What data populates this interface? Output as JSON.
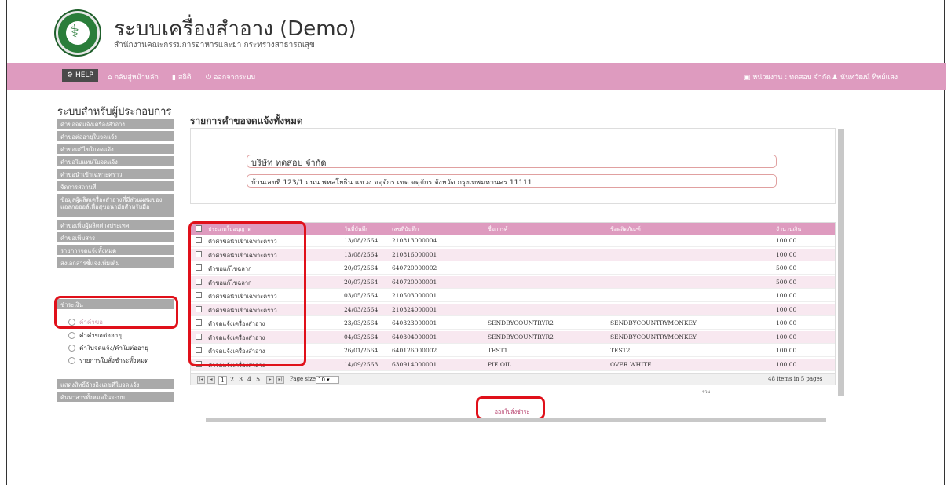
{
  "header": {
    "title": "ระบบเครื่องสำอาง (Demo)",
    "subtitle": "สำนักงานคณะกรรมการอาหารและยา กระทรวงสาธารณสุข"
  },
  "navbar": {
    "help": "HELP",
    "home": "กลับสู่หน้าหลัก",
    "stats": "สถิติ",
    "logout": "ออกจากระบบ",
    "agency": "หน่วยงาน : ทดสอบ จำกัด",
    "user": "นันทวัฒน์ ทิพย์แสง"
  },
  "sidebar": {
    "title": "ระบบสำหรับผู้ประกอบการ",
    "items": [
      "คำขอจดแจ้งเครื่องสำอาง",
      "คำขอต่ออายุใบจดแจ้ง",
      "คำขอแก้ไขใบจดแจ้ง",
      "คำขอใบแทนใบจดแจ้ง",
      "คำขอนำเข้าเฉพาะคราว",
      "จัดการสถานที่",
      "ข้อมูลผู้ผลิตเครื่องสำอางที่มีส่วนผสมของแอลกอฮอล์เพื่อสุขอนามัยสำหรับมือ",
      "คำขอเพิ่มผู้ผลิตต่างประเทศ",
      "คำขอเพิ่มสาร",
      "รายการจดแจ้งทั้งหมด",
      "ส่งเอกสารชี้แจงเพิ่มเติม",
      "ชำระเงิน",
      "แสดงสิทธิ์อ้างอิงเลขที่ใบจดแจ้ง",
      "ค้นหาสารทั้งหมดในระบบ"
    ],
    "sub_items": [
      "คำคำขอ",
      "คำคำขอต่ออายุ",
      "คำใบจดแจ้ง/คำใบต่ออายุ",
      "รายการใบสั่งชำระทั้งหมด"
    ]
  },
  "main": {
    "title": "รายการคำขอจดแจ้งทั้งหมด",
    "company_name": "บริษัท ทดสอบ จำกัด",
    "company_address": "บ้านเลขที่ 123/1 ถนน พหลโยธิน แขวง จตุจักร เขต จตุจักร จังหวัด กรุงเทพมหานคร 11111",
    "columns": [
      "ประเภทใบอนุญาต",
      "วันที่บันทึก",
      "เลขที่บันทึก",
      "ชื่อการค้า",
      "ชื่อผลิตภัณฑ์",
      "จำนวนเงิน"
    ],
    "rows": [
      [
        "คำคำขอนำเข้าเฉพาะคราว",
        "13/08/2564",
        "210813000004",
        "",
        "",
        "100.00"
      ],
      [
        "คำคำขอนำเข้าเฉพาะคราว",
        "13/08/2564",
        "210816000001",
        "",
        "",
        "100.00"
      ],
      [
        "คำขอแก้ไขฉลาก",
        "20/07/2564",
        "640720000002",
        "",
        "",
        "500.00"
      ],
      [
        "คำขอแก้ไขฉลาก",
        "20/07/2564",
        "640720000001",
        "",
        "",
        "500.00"
      ],
      [
        "คำคำขอนำเข้าเฉพาะคราว",
        "03/05/2564",
        "210503000001",
        "",
        "",
        "100.00"
      ],
      [
        "คำคำขอนำเข้าเฉพาะคราว",
        "24/03/2564",
        "210324000001",
        "",
        "",
        "100.00"
      ],
      [
        "คำจดแจ้งเครื่องสำอาง",
        "23/03/2564",
        "640323000001",
        "SENDBYCOUNTRYR2",
        "SENDBYCOUNTRYMONKEY",
        "100.00"
      ],
      [
        "คำจดแจ้งเครื่องสำอาง",
        "04/03/2564",
        "640304000001",
        "SENDBYCOUNTRYR2",
        "SENDBYCOUNTRYMONKEY",
        "100.00"
      ],
      [
        "คำจดแจ้งเครื่องสำอาง",
        "26/01/2564",
        "640126000002",
        "TEST1",
        "TEST2",
        "100.00"
      ],
      [
        "คำจดแจ้งเครื่องสำอาง",
        "14/09/2563",
        "630914000001",
        "PIE OIL",
        "OVER WHITE",
        "100.00"
      ]
    ],
    "pager": {
      "pages": [
        "1",
        "2",
        "3",
        "4",
        "5"
      ],
      "page_size_label": "Page size:",
      "page_size": "10",
      "summary": "48 items in 5 pages"
    },
    "total_label": "รวม",
    "issue_button": "ออกใบสั่งชำระ"
  },
  "colors": {
    "accent": "#de9bbf",
    "highlight": "#e0101a",
    "menu": "#a9a9a9"
  }
}
